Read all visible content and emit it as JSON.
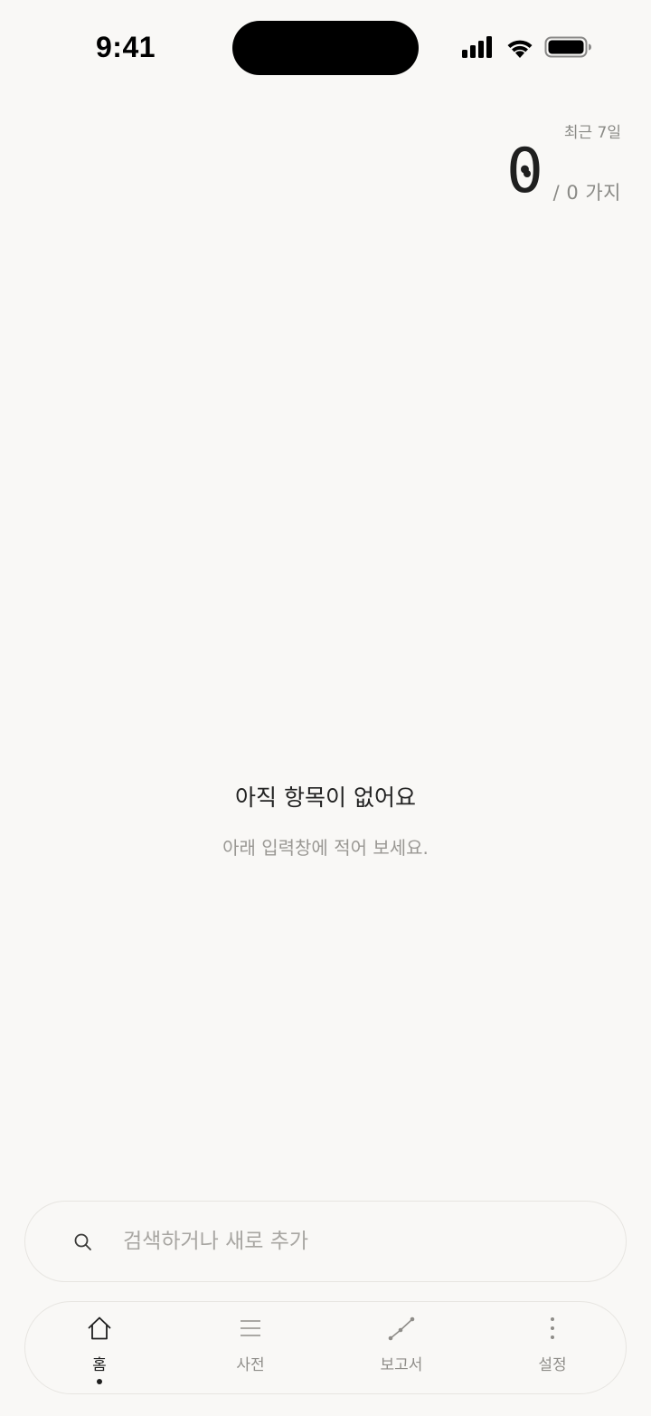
{
  "status_bar": {
    "time": "9:41"
  },
  "stats": {
    "period_label": "최근 7일",
    "count": "0",
    "total_label": "/ 0 가지"
  },
  "empty_state": {
    "title": "아직 항목이 없어요",
    "subtitle": "아래 입력창에 적어 보세요."
  },
  "search": {
    "placeholder": "검색하거나 새로 추가",
    "value": "",
    "icon": "search-icon"
  },
  "tabs": [
    {
      "label": "홈",
      "icon": "home-icon",
      "active": true
    },
    {
      "label": "사전",
      "icon": "list-icon",
      "active": false
    },
    {
      "label": "보고서",
      "icon": "chart-line-icon",
      "active": false
    },
    {
      "label": "설정",
      "icon": "more-vertical-icon",
      "active": false
    }
  ],
  "colors": {
    "background": "#f9f8f6",
    "text_primary": "#1f1f1f",
    "text_secondary": "#8a8a86",
    "border": "#e7e5e1"
  }
}
